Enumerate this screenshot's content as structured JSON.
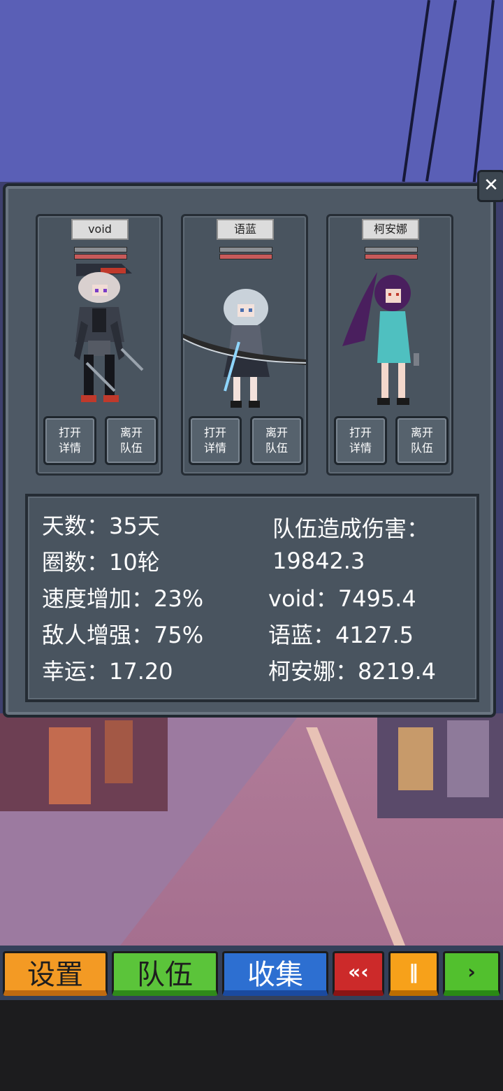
{
  "close_icon": "✕",
  "members": [
    {
      "name": "void",
      "open_details": "打开\n详情",
      "leave_team": "离开\n队伍"
    },
    {
      "name": "语蓝",
      "open_details": "打开\n详情",
      "leave_team": "离开\n队伍"
    },
    {
      "name": "柯安娜",
      "open_details": "打开\n详情",
      "leave_team": "离开\n队伍"
    }
  ],
  "stats": {
    "days": "天数：35天",
    "laps": "圈数：10轮",
    "speed_bonus": "速度增加：23%",
    "enemy_boost": "敌人增强：75%",
    "luck": "幸运：17.20",
    "team_damage_label": "队伍造成伤害：",
    "team_damage_value": "19842.3",
    "damage_void": "void：7495.4",
    "damage_yulan": "语蓝：4127.5",
    "damage_keanna": "柯安娜：8219.4"
  },
  "toolbar": {
    "settings": "设置",
    "team": "队伍",
    "collect": "收集",
    "rewind": "«‹",
    "pause": "‖",
    "play": "›"
  },
  "colors": {
    "sky": "#5a5fb6",
    "panel": "#4e5965",
    "settings_btn": "#f39a24",
    "team_btn": "#5bc43a",
    "collect_btn": "#2d6fd1",
    "rewind_btn": "#cc2a2a",
    "pause_btn": "#f7a11a",
    "play_btn": "#52c02e"
  }
}
